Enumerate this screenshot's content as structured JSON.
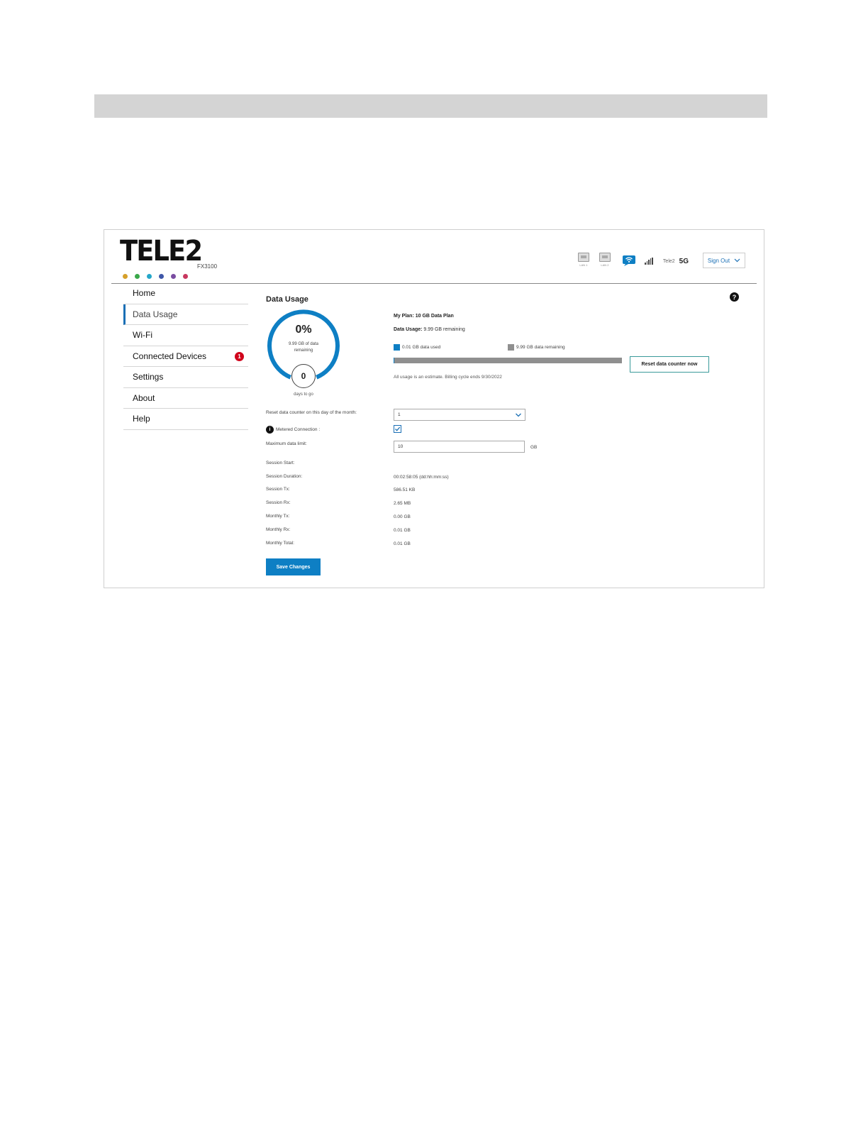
{
  "brand": {
    "name": "TELE2",
    "model": "FX3100",
    "dot_colors": [
      "#d6a02a",
      "#3aa84a",
      "#25a7c9",
      "#3f57a8",
      "#7a4da1",
      "#c8385f"
    ]
  },
  "header": {
    "lan1_label": "LAN 1",
    "lan2_label": "LAN 2",
    "carrier": "Tele2",
    "network": "5G",
    "signout_label": "Sign Out"
  },
  "sidebar": {
    "items": [
      {
        "label": "Home"
      },
      {
        "label": "Data Usage",
        "active": true
      },
      {
        "label": "Wi-Fi"
      },
      {
        "label": "Connected Devices",
        "badge": "1"
      },
      {
        "label": "Settings"
      },
      {
        "label": "About"
      },
      {
        "label": "Help"
      }
    ]
  },
  "main": {
    "title": "Data Usage",
    "help_symbol": "?",
    "gauge": {
      "percent_label": "0%",
      "percent_value": 0.001,
      "remaining_text": "9.99 GB of data remaining",
      "days_value": "0",
      "days_label": "days to go"
    },
    "plan_text": "My Plan: 10 GB Data Plan",
    "usage_label": "Data Usage:",
    "usage_value": " 9.99 GB remaining",
    "legend_used": "0.01 GB data used",
    "legend_remaining": "9.99 GB data remaining",
    "used_fraction": 0.001,
    "used_color": "#0e7fc4",
    "remaining_color": "#8f8f8f",
    "reset_button": "Reset data counter now",
    "estimate_text": "All usage is an estimate. Billing cycle ends 9/30/2022",
    "form": {
      "reset_day_label": "Reset data counter on this day of the month:",
      "reset_day_value": "1",
      "metered_label": "Metered Connection :",
      "metered_info_symbol": "i",
      "metered_checked": true,
      "max_limit_label": "Maximum data limit:",
      "max_limit_value": "10",
      "max_limit_unit": "GB"
    },
    "session": [
      {
        "label": "Session Start:",
        "value": ""
      },
      {
        "label": "Session Duration:",
        "value": "00:02:58:05 (dd:hh:mm:ss)"
      },
      {
        "label": "Session Tx:",
        "value": "586.51 KB"
      },
      {
        "label": "Session Rx:",
        "value": "2.65 MB"
      },
      {
        "label": "Monthly Tx:",
        "value": "0.00 GB"
      },
      {
        "label": "Monthly Rx:",
        "value": "0.01 GB"
      },
      {
        "label": "Monthly Total:",
        "value": "0.01 GB"
      }
    ],
    "save_button": "Save Changes"
  }
}
